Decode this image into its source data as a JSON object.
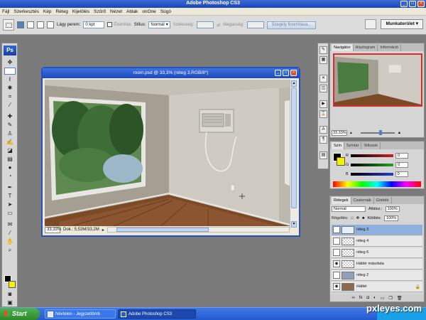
{
  "app": {
    "title": "Adobe Photoshop CS3",
    "window_buttons": [
      "_",
      "□",
      "×"
    ]
  },
  "menu": [
    "Fájl",
    "Szerkesztés",
    "Kép",
    "Réteg",
    "Kijelölés",
    "Szűrő",
    "Nézet",
    "Ablak",
    "onOne",
    "Súgó"
  ],
  "options": {
    "feather_label": "Lágy perem:",
    "feather_value": "0 kpt",
    "antialias_label": "Élsimítás",
    "style_label": "Stílus:",
    "style_value": "Normál",
    "width_label": "Szélesség:",
    "height_label": "Magasság:",
    "refine_label": "Szegély finomítása...",
    "workspace_label": "Munkaterület ▾"
  },
  "document": {
    "title": "room.psd @ 33,3% (réteg 3,RGB/8*)",
    "zoom": "33,33%",
    "doc_size": "Dok.: 5,53M/33,2M"
  },
  "navigator": {
    "tabs": [
      "Navigátor",
      "Hisztogram",
      "Információ"
    ],
    "zoom": "33,33%"
  },
  "color_panel": {
    "tabs": [
      "Szín",
      "Színtár",
      "Stílusok"
    ],
    "channels": [
      {
        "label": "R",
        "value": "0",
        "color": "#d02020"
      },
      {
        "label": "G",
        "value": "0",
        "color": "#20a020"
      },
      {
        "label": "B",
        "value": "0",
        "color": "#2040d0"
      }
    ]
  },
  "layers_panel": {
    "tabs": [
      "Rétegek",
      "Csatornák",
      "Görbék"
    ],
    "blend_mode": "Normál",
    "opacity_label": "Átlátsz.:",
    "opacity_value": "100%",
    "lock_label": "Rögzítés:",
    "fill_label": "Kitöltés:",
    "fill_value": "100%",
    "layers": [
      {
        "name": "réteg 3",
        "selected": true,
        "visible": false
      },
      {
        "name": "réteg 4",
        "selected": false,
        "visible": false
      },
      {
        "name": "réteg 6",
        "selected": false,
        "visible": false
      },
      {
        "name": "Háttér másolata",
        "selected": false,
        "visible": true
      },
      {
        "name": "réteg 2",
        "selected": false,
        "visible": false
      },
      {
        "name": "Háttér",
        "selected": false,
        "visible": true,
        "locked": true
      }
    ],
    "footer_icons": [
      "link-icon",
      "fx-icon",
      "mask-icon",
      "adjustment-icon",
      "folder-icon",
      "new-layer-icon",
      "trash-icon"
    ]
  },
  "taskbar": {
    "start_label": "Start",
    "tasks": [
      "Névtelen - Jegyzettömb",
      "Adobe Photoshop CS3"
    ]
  },
  "watermark": "pxleyes.com",
  "colors": {
    "accent": "#2350c2",
    "foreground": "#000000",
    "background": "#f1f200",
    "selected_layer": "#8fb0dc"
  }
}
